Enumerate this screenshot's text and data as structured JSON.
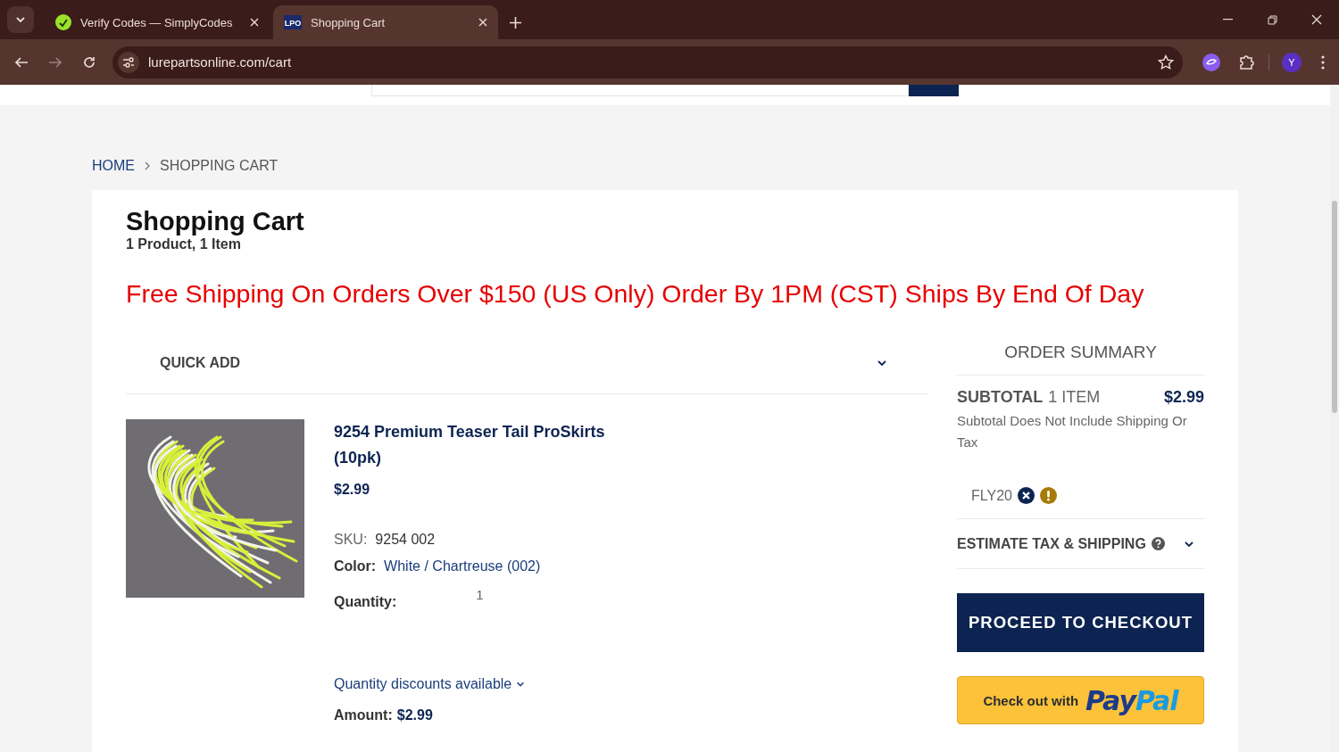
{
  "browser": {
    "tabs": [
      {
        "title": "Verify Codes — SimplyCodes",
        "kind": "simplycodes",
        "selected": false
      },
      {
        "title": "Shopping Cart",
        "kind": "lpo",
        "favicon_text": "LPO",
        "selected": true
      }
    ],
    "url": "lurepartsonline.com/cart",
    "profile_initial": "Y"
  },
  "breadcrumb": [
    {
      "label": "HOME",
      "kind": "link"
    },
    {
      "label": "SHOPPING CART",
      "kind": "current"
    }
  ],
  "cart": {
    "title": "Shopping Cart",
    "count": "1 Product, 1 Item",
    "promo": "Free Shipping On Orders Over $150 (US Only) Order By 1PM (CST) Ships By End Of Day",
    "quick_add": {
      "label": "QUICK ADD",
      "expanded": false
    },
    "items": [
      {
        "kind": "picture",
        "name": "9254 Premium Teaser Tail ProSkirts (10pk)",
        "price": "$2.99",
        "sku_label": "SKU:",
        "sku": "9254 002",
        "color_label": "Color:",
        "color_name": "White / Chartreuse (002)",
        "quantity_label": "Quantity:",
        "quantity": "1",
        "discounts": "Quantity discounts available",
        "amount_label": "Amount:",
        "amount": "$2.99"
      }
    ]
  },
  "summary": {
    "title": "ORDER SUMMARY",
    "subtotal_label": "SUBTOTAL",
    "subtotal_items": "1 ITEM",
    "subtotal": "$2.99",
    "note": "Subtotal Does Not Include Shipping Or Tax",
    "coupon": "FLY20",
    "estimate": {
      "label": "ESTIMATE TAX & SHIPPING",
      "expanded": false
    },
    "checkout": "PROCEED TO CHECKOUT",
    "paypal": {
      "label": "Check out with",
      "logo_pay": "Pay",
      "logo_pal": "Pal"
    }
  }
}
